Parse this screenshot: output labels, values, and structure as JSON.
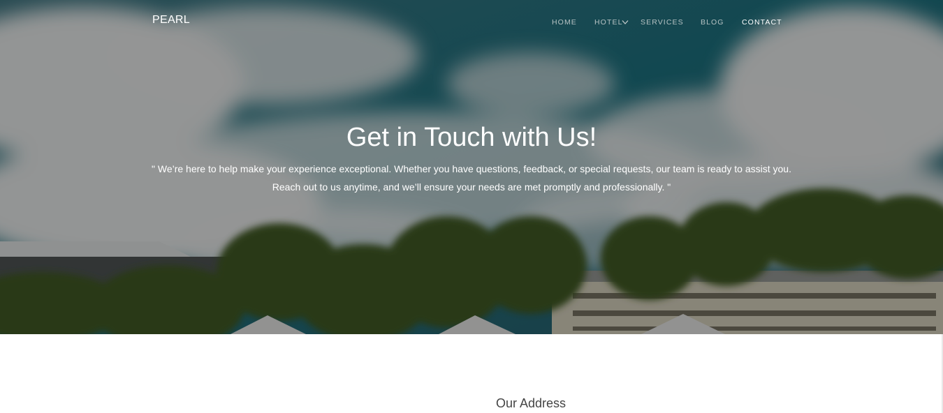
{
  "brand": {
    "name": "PEARL"
  },
  "nav": {
    "items": [
      {
        "label": "HOME",
        "active": false,
        "has_dropdown": false
      },
      {
        "label": "HOTEL",
        "active": false,
        "has_dropdown": true
      },
      {
        "label": "SERVICES",
        "active": false,
        "has_dropdown": false
      },
      {
        "label": "BLOG",
        "active": false,
        "has_dropdown": false
      },
      {
        "label": "CONTACT",
        "active": true,
        "has_dropdown": false
      }
    ]
  },
  "hero": {
    "title": "Get in Touch with Us!",
    "text": "\" We’re here to help make your experience exceptional. Whether you have questions, feedback, or special requests, our team is ready to assist you. Reach out to us anytime, and we’ll ensure your needs are met promptly and professionally. \""
  },
  "address": {
    "heading": "Our Address"
  },
  "colors": {
    "sky": "#1f5f6b",
    "overlay": "#000000",
    "nav_text": "#d2d7d7",
    "heading_text": "#444444"
  },
  "icons": {
    "dropdown": "chevron-down-icon"
  }
}
